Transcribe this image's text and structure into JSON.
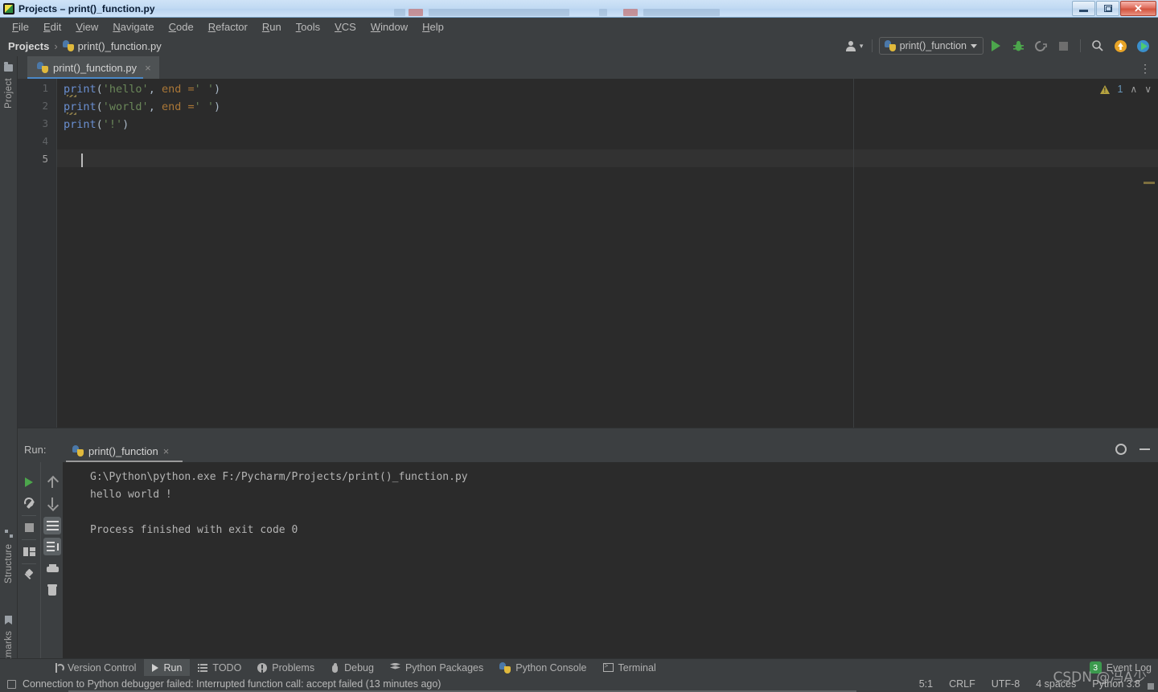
{
  "window": {
    "title": "Projects – print()_function.py",
    "app_icon": "pycharm-icon",
    "minimize_label": "Minimize",
    "maximize_label": "Restore",
    "close_label": "✕"
  },
  "menubar": {
    "items": [
      {
        "label": "File",
        "mnemonic": "F"
      },
      {
        "label": "Edit",
        "mnemonic": "E"
      },
      {
        "label": "View",
        "mnemonic": "V"
      },
      {
        "label": "Navigate",
        "mnemonic": "N"
      },
      {
        "label": "Code",
        "mnemonic": "C"
      },
      {
        "label": "Refactor",
        "mnemonic": "R"
      },
      {
        "label": "Run",
        "mnemonic": "R"
      },
      {
        "label": "Tools",
        "mnemonic": "T"
      },
      {
        "label": "VCS",
        "mnemonic": "V"
      },
      {
        "label": "Window",
        "mnemonic": "W"
      },
      {
        "label": "Help",
        "mnemonic": "H"
      }
    ]
  },
  "navbar": {
    "breadcrumb_root": "Projects",
    "breadcrumb_separator": "›",
    "breadcrumb_file": "print()_function.py",
    "run_config": "print()_function",
    "icons": [
      "user-icon",
      "run-icon",
      "debug-icon",
      "coverage-icon",
      "stop-icon",
      "search-icon",
      "update-icon",
      "run-anything-icon"
    ]
  },
  "editor": {
    "tab": {
      "label": "print()_function.py",
      "close": "×"
    },
    "more_actions": "⋮",
    "gutter_lines": [
      "1",
      "2",
      "3",
      "4",
      "5"
    ],
    "current_line_index": 4,
    "lines": [
      {
        "n": 1,
        "tokens": [
          {
            "t": "print",
            "c": "fn"
          },
          {
            "t": "(",
            "c": "punct"
          },
          {
            "t": "'hello'",
            "c": "str"
          },
          {
            "t": ", ",
            "c": "punct"
          },
          {
            "t": "end",
            "c": "kw"
          },
          {
            "t": " =",
            "c": "kw"
          },
          {
            "t": "' '",
            "c": "str"
          },
          {
            "t": ")",
            "c": "punct"
          }
        ]
      },
      {
        "n": 2,
        "tokens": [
          {
            "t": "print",
            "c": "fn"
          },
          {
            "t": "(",
            "c": "punct"
          },
          {
            "t": "'world'",
            "c": "str"
          },
          {
            "t": ", ",
            "c": "punct"
          },
          {
            "t": "end",
            "c": "kw"
          },
          {
            "t": " =",
            "c": "kw"
          },
          {
            "t": "' '",
            "c": "str"
          },
          {
            "t": ")",
            "c": "punct"
          }
        ]
      },
      {
        "n": 3,
        "tokens": [
          {
            "t": "print",
            "c": "fn"
          },
          {
            "t": "(",
            "c": "punct"
          },
          {
            "t": "'!'",
            "c": "str"
          },
          {
            "t": ")",
            "c": "punct"
          }
        ]
      },
      {
        "n": 4,
        "tokens": []
      },
      {
        "n": 5,
        "tokens": []
      }
    ],
    "inspection": {
      "icon": "warning-triangle-icon",
      "count": "1",
      "prev": "∧",
      "next": "∨"
    }
  },
  "run_window": {
    "title": "Run:",
    "tab_label": "print()_function",
    "tab_close": "×",
    "settings_icon": "gear-icon",
    "hide_icon": "minimize-icon",
    "left_tools": [
      "rerun-icon",
      "settings-icon",
      "stop-icon",
      "layout-icon",
      "pin-icon"
    ],
    "right_tools": [
      "arrow-up-icon",
      "arrow-down-icon",
      "soft-wrap-icon",
      "scroll-to-end-icon",
      "print-icon",
      "clear-all-icon"
    ],
    "console_lines": [
      "G:\\Python\\python.exe F:/Pycharm/Projects/print()_function.py",
      "hello world !",
      "",
      "Process finished with exit code 0"
    ]
  },
  "left_strips": {
    "top": [
      {
        "label": "Project",
        "icon": "folder-icon"
      }
    ],
    "bottom": [
      {
        "label": "Structure",
        "icon": "structure-icon"
      },
      {
        "label": "Bookmarks",
        "icon": "bookmark-icon"
      }
    ]
  },
  "bottom_bar": {
    "tabs": [
      {
        "label": "Version Control",
        "icon": "branch-icon",
        "active": false
      },
      {
        "label": "Run",
        "icon": "run-icon",
        "active": true
      },
      {
        "label": "TODO",
        "icon": "todo-icon",
        "active": false
      },
      {
        "label": "Problems",
        "icon": "problems-icon",
        "active": false
      },
      {
        "label": "Debug",
        "icon": "bug-icon",
        "active": false
      },
      {
        "label": "Python Packages",
        "icon": "packages-icon",
        "active": false
      },
      {
        "label": "Python Console",
        "icon": "python-icon",
        "active": false
      },
      {
        "label": "Terminal",
        "icon": "terminal-icon",
        "active": false
      }
    ],
    "event_log": {
      "label": "Event Log",
      "badge": "3"
    }
  },
  "status_bar": {
    "message_icon": "message-icon",
    "message": "Connection to Python debugger failed: Interrupted function call: accept failed (13 minutes ago)",
    "caret_position": "5:1",
    "line_separator": "CRLF",
    "encoding": "UTF-8",
    "indent": "4 spaces",
    "interpreter": "Python 3.8"
  },
  "watermark": "CSDN @冯A少",
  "colors": {
    "accent": "#4b88c7",
    "bg_editor": "#2b2b2b",
    "bg_chrome": "#3c3f41",
    "string": "#6a8759",
    "function": "#6a8fd0",
    "keyword": "#aa7737",
    "punct": "#a9b7c6",
    "warn": "#b5a23f",
    "badge_green": "#3c9a4e"
  }
}
